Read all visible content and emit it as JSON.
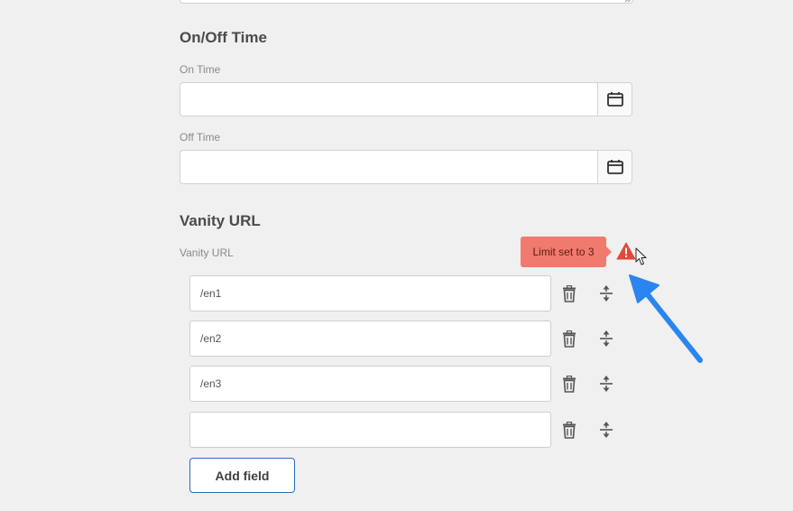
{
  "on_off": {
    "title": "On/Off Time",
    "on_label": "On Time",
    "on_value": "",
    "off_label": "Off Time",
    "off_value": ""
  },
  "vanity": {
    "title": "Vanity URL",
    "label": "Vanity URL",
    "tooltip": "Limit set to 3",
    "fields": [
      "/en1",
      "/en2",
      "/en3",
      ""
    ],
    "add_label": "Add field"
  },
  "icons": {
    "calendar": "calendar-icon",
    "delete": "trash-icon",
    "reorder": "reorder-icon",
    "warning": "warning-icon",
    "annotation": "blue-arrow",
    "pointer": "mouse-cursor"
  },
  "colors": {
    "tooltip_bg": "#f17a6e",
    "warning": "#e3483a",
    "annotation_arrow": "#2a85f0",
    "button_border": "#2c6cbd"
  }
}
